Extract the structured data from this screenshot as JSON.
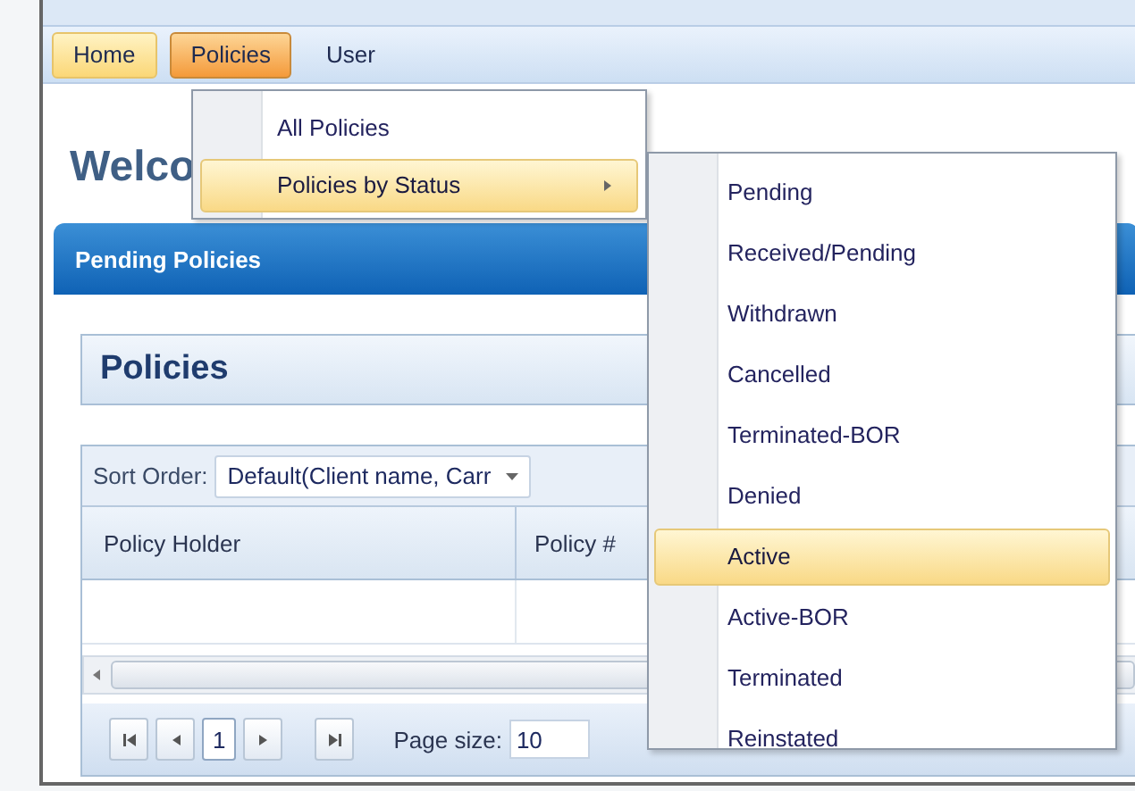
{
  "menubar": {
    "items": [
      {
        "label": "Home",
        "selected": false,
        "highlighted": true
      },
      {
        "label": "Policies",
        "selected": true,
        "highlighted": false
      },
      {
        "label": "User",
        "selected": false,
        "highlighted": false
      }
    ]
  },
  "heading": "Welco",
  "panel": {
    "title": "Pending Policies",
    "section_title": "Policies",
    "sort": {
      "label": "Sort Order:",
      "value": "Default(Client name, Carr"
    },
    "table": {
      "columns": [
        "Policy Holder",
        "Policy #"
      ]
    },
    "pager": {
      "pages": [
        {
          "label": "1",
          "selected": true
        }
      ],
      "page_size_label": "Page size:",
      "page_size": "10"
    }
  },
  "menu": {
    "items": [
      {
        "label": "All Policies",
        "selected": false,
        "submenu": false
      },
      {
        "label": "Policies by Status",
        "selected": true,
        "submenu": true
      }
    ]
  },
  "submenu": {
    "items": [
      {
        "label": "Pending",
        "selected": false
      },
      {
        "label": "Received/Pending",
        "selected": false
      },
      {
        "label": "Withdrawn",
        "selected": false
      },
      {
        "label": "Cancelled",
        "selected": false
      },
      {
        "label": "Terminated-BOR",
        "selected": false
      },
      {
        "label": "Denied",
        "selected": false
      },
      {
        "label": "Active",
        "selected": true
      },
      {
        "label": "Active-BOR",
        "selected": false
      },
      {
        "label": "Terminated",
        "selected": false
      },
      {
        "label": "Reinstated",
        "selected": false
      }
    ]
  }
}
